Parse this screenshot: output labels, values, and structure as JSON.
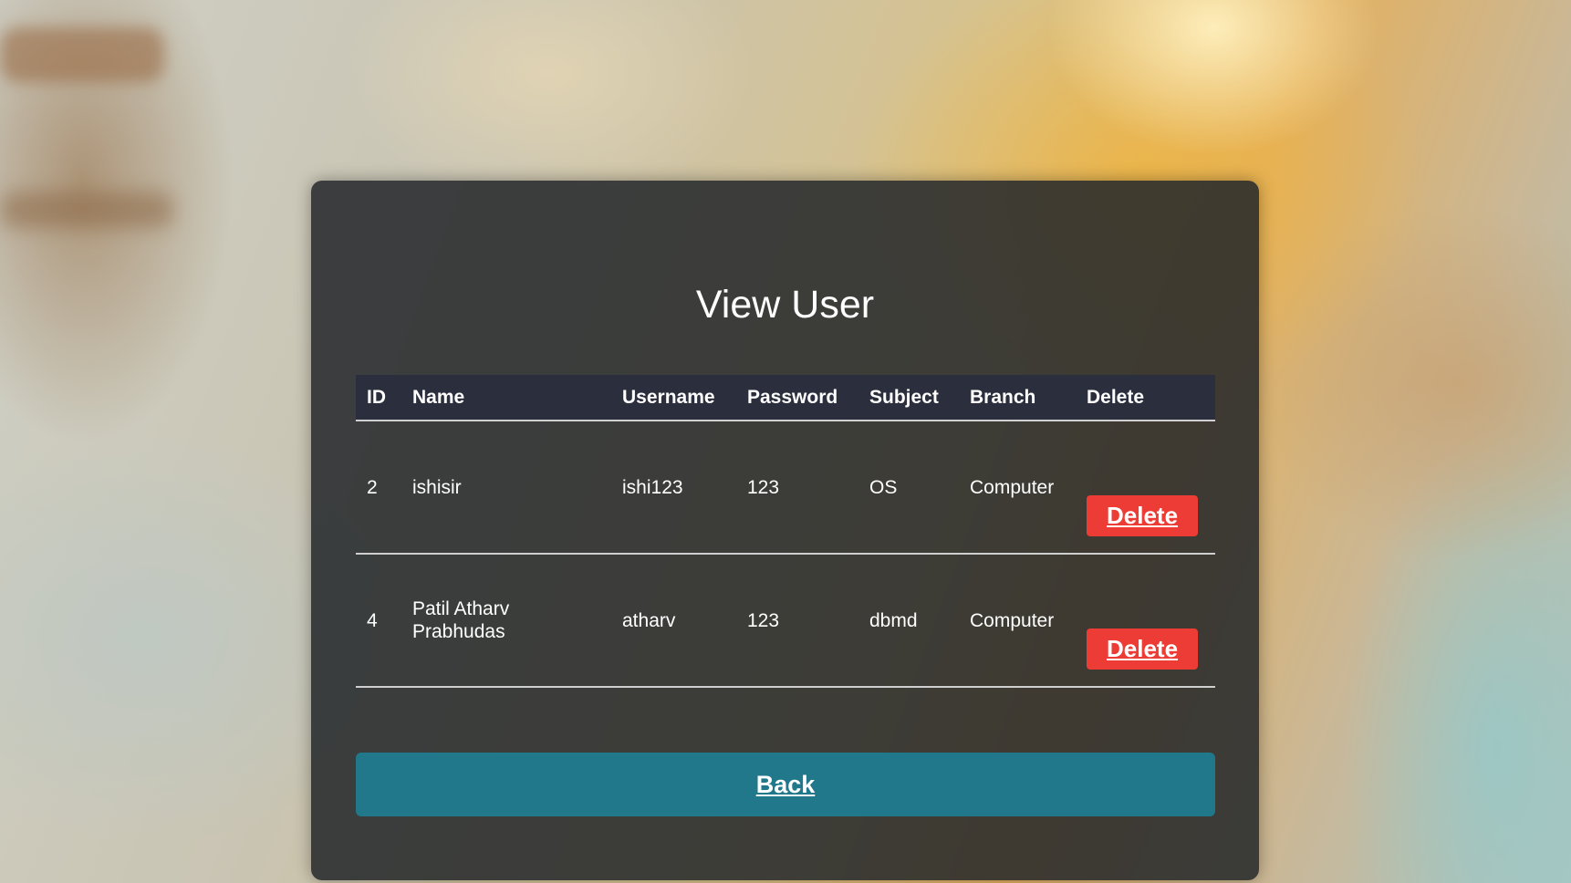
{
  "page": {
    "title": "View User"
  },
  "table": {
    "headers": {
      "id": "ID",
      "name": "Name",
      "username": "Username",
      "password": "Password",
      "subject": "Subject",
      "branch": "Branch",
      "delete": "Delete"
    },
    "rows": [
      {
        "id": "2",
        "name": "ishisir",
        "username": "ishi123",
        "password": "123",
        "subject": "OS",
        "branch": "Computer",
        "delete_label": "Delete"
      },
      {
        "id": "4",
        "name": "Patil Atharv Prabhudas",
        "username": "atharv",
        "password": "123",
        "subject": "dbmd",
        "branch": "Computer",
        "delete_label": "Delete"
      }
    ]
  },
  "actions": {
    "back_label": "Back"
  },
  "colors": {
    "delete_button": "#ec3c35",
    "back_button": "#21788a",
    "panel": "#23262a"
  }
}
